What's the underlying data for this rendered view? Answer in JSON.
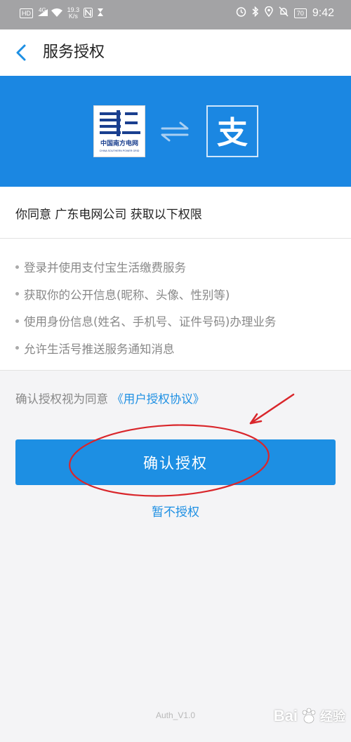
{
  "status_bar": {
    "network_badge": "HD",
    "signal": "4G",
    "speed_value": "19.3",
    "speed_unit": "K/s",
    "battery": "70",
    "time": "9:42"
  },
  "nav": {
    "title": "服务授权"
  },
  "banner": {
    "partner_logo_name": "中国南方电网",
    "partner_logo_sub": "CHINA SOUTHERN POWER GRID",
    "alipay_glyph": "支"
  },
  "permission": {
    "header": "你同意 广东电网公司 获取以下权限",
    "items": [
      "登录并使用支付宝生活缴费服务",
      "获取你的公开信息(昵称、头像、性别等)",
      "使用身份信息(姓名、手机号、证件号码)办理业务",
      "允许生活号推送服务通知消息"
    ]
  },
  "agreement": {
    "prefix": "确认授权视为同意",
    "link": "《用户授权协议》"
  },
  "actions": {
    "confirm_label": "确认授权",
    "decline_label": "暂不授权"
  },
  "footer": {
    "version": "Auth_V1.0",
    "watermark_brand": "Bai",
    "watermark_text": "经验"
  },
  "colors": {
    "brand_blue": "#1d8fe3",
    "banner_blue": "#1b87e2",
    "annotation_red": "#d9262b"
  }
}
